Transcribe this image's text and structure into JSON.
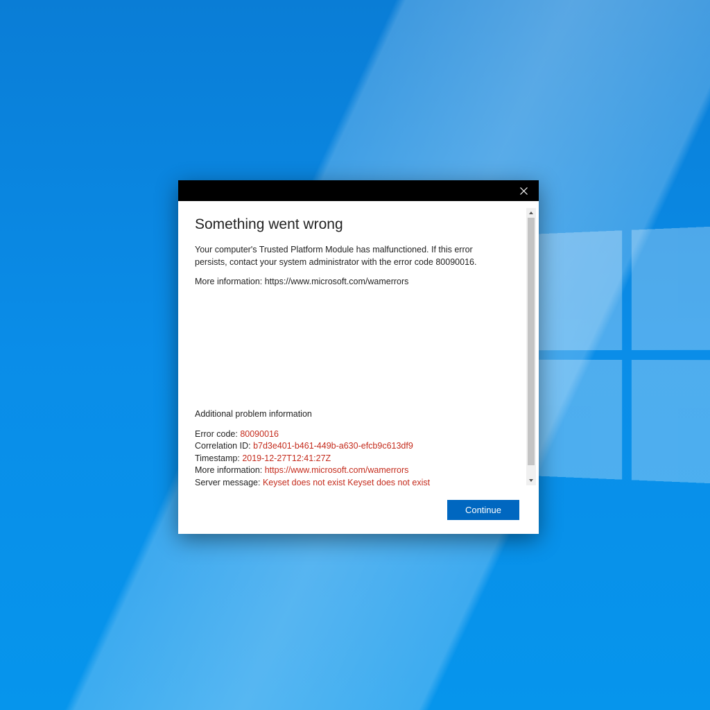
{
  "dialog": {
    "title": "Something went wrong",
    "message": "Your computer's Trusted Platform Module has malfunctioned. If this error persists, contact your system administrator with the error code 80090016.",
    "more_info_label": "More information: ",
    "more_info_url": "https://www.microsoft.com/wamerrors",
    "additional_heading": "Additional problem information",
    "details": {
      "error_code_label": "Error code: ",
      "error_code_value": "80090016",
      "correlation_label": "Correlation ID: ",
      "correlation_value": "b7d3e401-b461-449b-a630-efcb9c613df9",
      "timestamp_label": "Timestamp: ",
      "timestamp_value": "2019-12-27T12:41:27Z",
      "moreinfo_label": "More information: ",
      "moreinfo_value": "https://www.microsoft.com/wamerrors",
      "server_label": "Server message: ",
      "server_value": "Keyset does not exist Keyset does not exist"
    },
    "continue_label": "Continue"
  }
}
